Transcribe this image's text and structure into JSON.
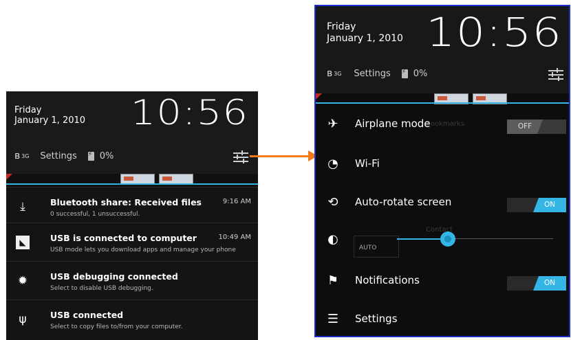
{
  "left": {
    "day": "Friday",
    "date": "January 1, 2010",
    "time": "10:56",
    "network": "3G",
    "settings_label": "Settings",
    "battery": "0%",
    "notifications": [
      {
        "title": "Bluetooth share: Received files",
        "sub": "0 successful, 1 unsuccessful.",
        "time": "9:16 AM",
        "icon": "download-icon"
      },
      {
        "title": "USB is connected to computer",
        "sub": "USB mode lets you download apps and manage your phone",
        "time": "10:49 AM",
        "icon": "usb-storage-icon"
      },
      {
        "title": "USB debugging connected",
        "sub": "Select to disable USB debugging.",
        "time": "",
        "icon": "android-debug-icon"
      },
      {
        "title": "USB connected",
        "sub": "Select to copy files to/from your computer.",
        "time": "",
        "icon": "usb-icon"
      }
    ]
  },
  "right": {
    "day": "Friday",
    "date": "January 1, 2010",
    "time": "10:56",
    "network": "3G",
    "settings_label": "Settings",
    "battery": "0%",
    "quick_settings": [
      {
        "label": "Airplane mode",
        "icon": "airplane-icon",
        "toggle": "OFF"
      },
      {
        "label": "Wi-Fi",
        "icon": "wifi-icon",
        "toggle": ""
      },
      {
        "label": "Auto-rotate screen",
        "icon": "rotate-icon",
        "toggle": "ON"
      },
      {
        "label": "Notifications",
        "icon": "notifications-icon",
        "toggle": "ON"
      },
      {
        "label": "Settings",
        "icon": "settings-sliders-icon",
        "toggle": ""
      }
    ],
    "brightness": {
      "auto_label": "AUTO",
      "level": 0.32
    },
    "ghost_text": {
      "bookmarks": "Bookmarks",
      "contact": "Contact"
    }
  },
  "colors": {
    "accent": "#33b5e5",
    "arrow": "#f07a1c",
    "frame": "#1c30c9"
  }
}
